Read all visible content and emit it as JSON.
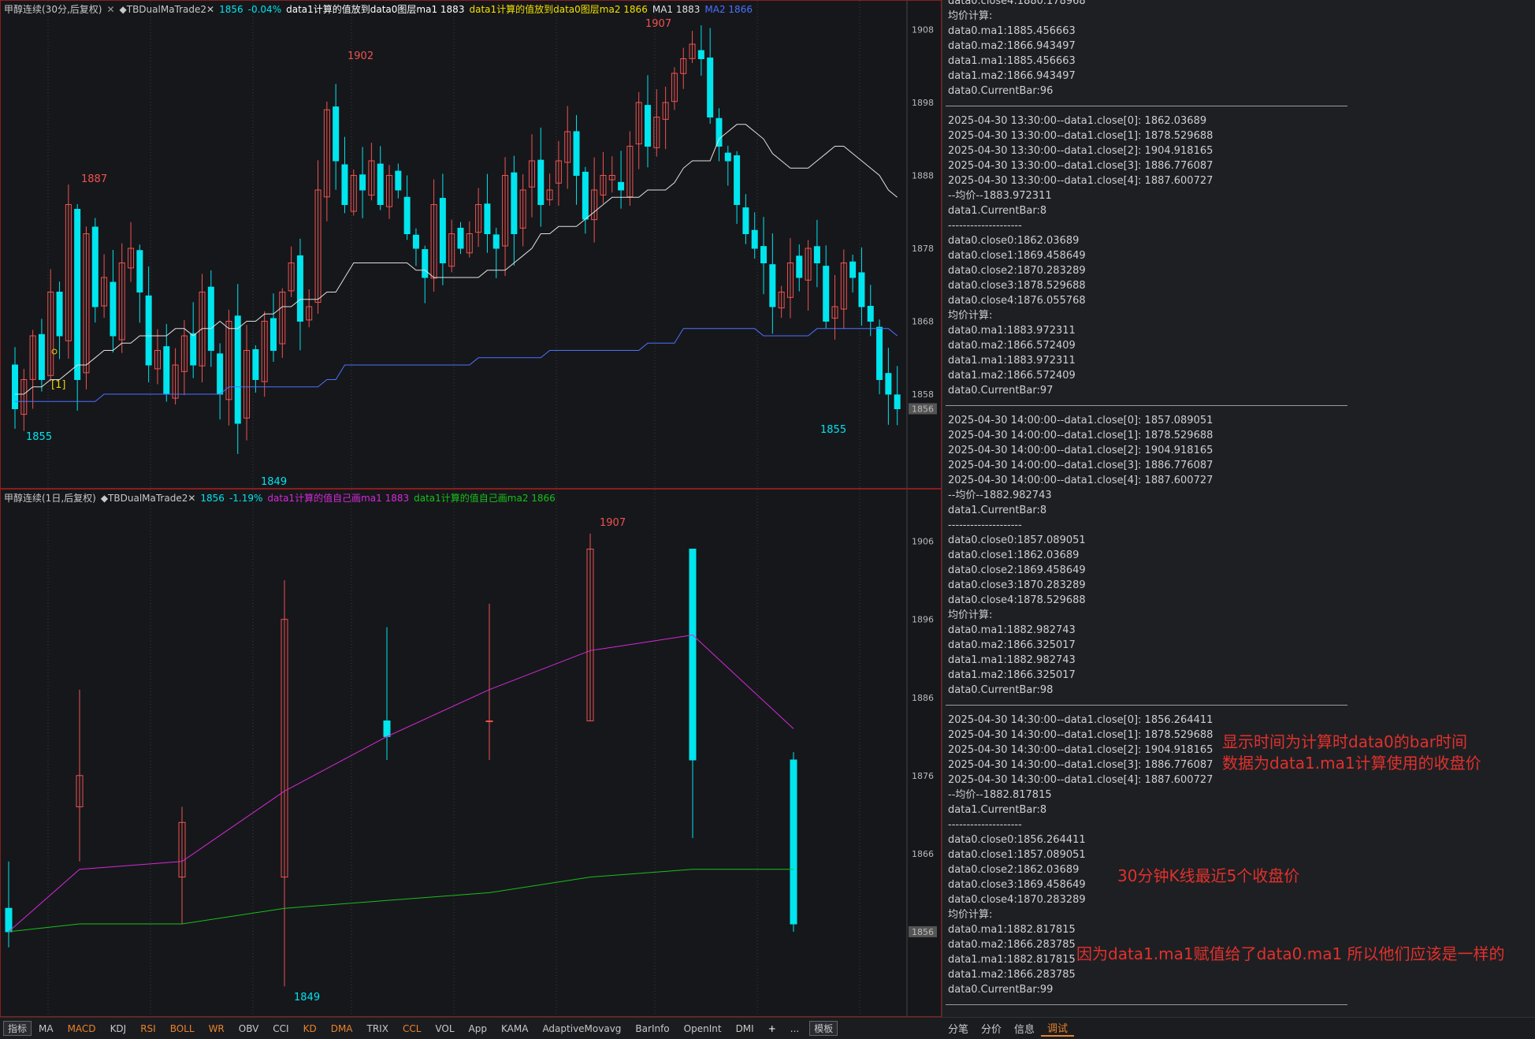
{
  "colors": {
    "up": "#ef5350",
    "down": "#00e5ee",
    "ma1": "#e0e0e0",
    "ma2": "#4a72ff",
    "ma1_daily": "#d62ad6",
    "ma2_daily": "#18c018",
    "label_cyan": "#00e5ee",
    "label_red": "#ef5350",
    "note": "#e2312b",
    "tab_orange": "#e8832a"
  },
  "pane1": {
    "header": [
      {
        "text": "甲醇连续(30分,后复权)",
        "color": "#c8c8c8"
      },
      {
        "text": "✕",
        "color": "#9a9a9a"
      },
      {
        "text": "◆TBDualMaTrade2✕",
        "color": "#c8c8c8"
      },
      {
        "text": "1856",
        "color": "#00e5ee"
      },
      {
        "text": "-0.04%",
        "color": "#00e5ee"
      },
      {
        "text": "data1计算的值放到data0图层ma1 1883",
        "color": "#ffffff"
      },
      {
        "text": "data1计算的值放到data0图层ma2 1866",
        "color": "#f2e000"
      },
      {
        "text": "MA1 1883",
        "color": "#e0e0e0"
      },
      {
        "text": "MA2 1866",
        "color": "#4a72ff"
      }
    ],
    "y_ticks": [
      "1908",
      "1898",
      "1888",
      "1878",
      "1868",
      "1858"
    ],
    "last_price": "1856",
    "annotations": {
      "high_left": "1887",
      "high_mid": "1902",
      "high_right": "1907",
      "low_left": "1855",
      "low_mid": "1849",
      "low_right": "1855",
      "signal": "[1]"
    }
  },
  "pane2": {
    "header": [
      {
        "text": "甲醇连续(1日,后复权)",
        "color": "#c8c8c8"
      },
      {
        "text": "◆TBDualMaTrade2✕",
        "color": "#c8c8c8"
      },
      {
        "text": "1856",
        "color": "#00e5ee"
      },
      {
        "text": "-1.19%",
        "color": "#00e5ee"
      },
      {
        "text": "data1计算的值自己画ma1 1883",
        "color": "#d62ad6"
      },
      {
        "text": "data1计算的值自己画ma2 1866",
        "color": "#18c018"
      }
    ],
    "y_ticks": [
      "1906",
      "1896",
      "1886",
      "1876",
      "1866"
    ],
    "last_price": "1856",
    "annotations": {
      "high": "1907",
      "low": "1849"
    }
  },
  "chart_data": [
    {
      "type": "candlestick",
      "title": "甲醇连续(30分,后复权)",
      "ylim": [
        1846,
        1910
      ],
      "y_ticks": [
        1908,
        1898,
        1888,
        1878,
        1868,
        1858
      ],
      "ma1": [
        1858,
        1858,
        1859,
        1859,
        1860,
        1860,
        1861,
        1862,
        1862,
        1863,
        1864,
        1864,
        1865,
        1865,
        1866,
        1866,
        1866,
        1866,
        1867,
        1867,
        1866,
        1867,
        1867,
        1868,
        1867,
        1867,
        1868,
        1868,
        1869,
        1869,
        1870,
        1870,
        1871,
        1871,
        1871,
        1872,
        1872,
        1874,
        1876,
        1876,
        1876,
        1876,
        1876,
        1876,
        1876,
        1875,
        1875,
        1874,
        1874,
        1874,
        1874,
        1874,
        1874,
        1875,
        1875,
        1875,
        1876,
        1877,
        1878,
        1880,
        1880,
        1881,
        1881,
        1881,
        1882,
        1883,
        1884,
        1885,
        1885,
        1885,
        1885,
        1886,
        1886,
        1886,
        1887,
        1889,
        1890,
        1890,
        1890,
        1893,
        1894,
        1895,
        1895,
        1894,
        1893,
        1891,
        1890,
        1889,
        1889,
        1889,
        1890,
        1891,
        1892,
        1892,
        1891,
        1890,
        1889,
        1888,
        1886,
        1885
      ],
      "ma2": [
        1857,
        1857,
        1857,
        1857,
        1857,
        1857,
        1857,
        1857,
        1857,
        1857,
        1858,
        1858,
        1858,
        1858,
        1858,
        1858,
        1858,
        1858,
        1858,
        1858,
        1858,
        1858,
        1858,
        1858,
        1859,
        1859,
        1859,
        1859,
        1859,
        1859,
        1859,
        1859,
        1859,
        1859,
        1859,
        1860,
        1860,
        1862,
        1862,
        1862,
        1862,
        1862,
        1862,
        1862,
        1862,
        1862,
        1862,
        1862,
        1862,
        1862,
        1862,
        1862,
        1863,
        1863,
        1863,
        1863,
        1863,
        1863,
        1863,
        1863,
        1864,
        1864,
        1864,
        1864,
        1864,
        1864,
        1864,
        1864,
        1864,
        1864,
        1864,
        1865,
        1865,
        1865,
        1865,
        1867,
        1867,
        1867,
        1867,
        1867,
        1867,
        1867,
        1867,
        1867,
        1866,
        1866,
        1866,
        1866,
        1866,
        1866,
        1867,
        1867,
        1867,
        1867,
        1867,
        1867,
        1867,
        1867,
        1867,
        1866
      ]
    },
    {
      "type": "candlestick",
      "title": "甲醇连续(1日,后复权)",
      "ylim": [
        1846,
        1910
      ],
      "y_ticks": [
        1906,
        1896,
        1886,
        1876,
        1866
      ],
      "candles": [
        {
          "o": 1859,
          "h": 1865,
          "l": 1854,
          "c": 1856
        },
        {
          "o": 1872,
          "h": 1887,
          "l": 1865,
          "c": 1876
        },
        {
          "o": 1863,
          "h": 1872,
          "l": 1857,
          "c": 1870
        },
        {
          "o": 1863,
          "h": 1901,
          "l": 1849,
          "c": 1896
        },
        {
          "o": 1883,
          "h": 1895,
          "l": 1878,
          "c": 1881
        },
        {
          "o": 1883,
          "h": 1898,
          "l": 1878,
          "c": 1883
        },
        {
          "o": 1883,
          "h": 1907,
          "l": 1883,
          "c": 1905
        },
        {
          "o": 1905,
          "h": 1905,
          "l": 1868,
          "c": 1878
        },
        {
          "o": 1878,
          "h": 1879,
          "l": 1856,
          "c": 1857
        }
      ],
      "ma1": [
        1856,
        1864,
        1865,
        1874,
        1881,
        1887,
        1892,
        1894,
        1882
      ],
      "ma2": [
        1856,
        1857,
        1857,
        1859,
        1860,
        1861,
        1863,
        1864,
        1864
      ]
    }
  ],
  "bottom_tabs": [
    {
      "label": "指标",
      "color": "#c8c8c8",
      "boxed": true
    },
    {
      "label": "MA",
      "color": "#c8c8c8"
    },
    {
      "label": "MACD",
      "color": "#e8832a"
    },
    {
      "label": "KDJ",
      "color": "#c8c8c8"
    },
    {
      "label": "RSI",
      "color": "#e8832a"
    },
    {
      "label": "BOLL",
      "color": "#e8832a"
    },
    {
      "label": "WR",
      "color": "#e8832a"
    },
    {
      "label": "OBV",
      "color": "#c8c8c8"
    },
    {
      "label": "CCI",
      "color": "#c8c8c8"
    },
    {
      "label": "KD",
      "color": "#e8832a"
    },
    {
      "label": "DMA",
      "color": "#e8832a"
    },
    {
      "label": "TRIX",
      "color": "#c8c8c8"
    },
    {
      "label": "CCL",
      "color": "#e8832a"
    },
    {
      "label": "VOL",
      "color": "#c8c8c8"
    },
    {
      "label": "App",
      "color": "#c8c8c8"
    },
    {
      "label": "KAMA",
      "color": "#c8c8c8"
    },
    {
      "label": "AdaptiveMovavg",
      "color": "#c8c8c8"
    },
    {
      "label": "BarInfo",
      "color": "#c8c8c8"
    },
    {
      "label": "OpenInt",
      "color": "#c8c8c8"
    },
    {
      "label": "DMI",
      "color": "#c8c8c8"
    },
    {
      "label": "+",
      "color": "#ffffff"
    },
    {
      "label": "...",
      "color": "#c8c8c8"
    },
    {
      "label": "模板",
      "color": "#c8c8c8",
      "boxed": true
    }
  ],
  "right_tabs": [
    {
      "label": "分笔",
      "active": false
    },
    {
      "label": "分价",
      "active": false
    },
    {
      "label": "信息",
      "active": false
    },
    {
      "label": "调试",
      "active": true
    }
  ],
  "log": [
    "data0.close4:1880.178968",
    "均价计算:",
    "data0.ma1:1885.456663",
    "data0.ma2:1866.943497",
    "data1.ma1:1885.456663",
    "data1.ma2:1866.943497",
    "data0.CurrentBar:96",
    "---",
    "2025-04-30 13:30:00--data1.close[0]:  1862.03689",
    "2025-04-30 13:30:00--data1.close[1]:  1878.529688",
    "2025-04-30 13:30:00--data1.close[2]:  1904.918165",
    "2025-04-30 13:30:00--data1.close[3]:  1886.776087",
    "2025-04-30 13:30:00--data1.close[4]:  1887.600727",
    "--均价--1883.972311",
    "data1.CurrentBar:8",
    "--------------------",
    "data0.close0:1862.03689",
    "data0.close1:1869.458649",
    "data0.close2:1870.283289",
    "data0.close3:1878.529688",
    "data0.close4:1876.055768",
    "均价计算:",
    "data0.ma1:1883.972311",
    "data0.ma2:1866.572409",
    "data1.ma1:1883.972311",
    "data1.ma2:1866.572409",
    "data0.CurrentBar:97",
    "---",
    "2025-04-30 14:00:00--data1.close[0]:  1857.089051",
    "2025-04-30 14:00:00--data1.close[1]:  1878.529688",
    "2025-04-30 14:00:00--data1.close[2]:  1904.918165",
    "2025-04-30 14:00:00--data1.close[3]:  1886.776087",
    "2025-04-30 14:00:00--data1.close[4]:  1887.600727",
    "--均价--1882.982743",
    "data1.CurrentBar:8",
    "--------------------",
    "data0.close0:1857.089051",
    "data0.close1:1862.03689",
    "data0.close2:1869.458649",
    "data0.close3:1870.283289",
    "data0.close4:1878.529688",
    "均价计算:",
    "data0.ma1:1882.982743",
    "data0.ma2:1866.325017",
    "data1.ma1:1882.982743",
    "data1.ma2:1866.325017",
    "data0.CurrentBar:98",
    "---",
    "2025-04-30 14:30:00--data1.close[0]:  1856.264411",
    "2025-04-30 14:30:00--data1.close[1]:  1878.529688",
    "2025-04-30 14:30:00--data1.close[2]:  1904.918165",
    "2025-04-30 14:30:00--data1.close[3]:  1886.776087",
    "2025-04-30 14:30:00--data1.close[4]:  1887.600727",
    "--均价--1882.817815",
    "data1.CurrentBar:8",
    "--------------------",
    "data0.close0:1856.264411",
    "data0.close1:1857.089051",
    "data0.close2:1862.03689",
    "data0.close3:1869.458649",
    "data0.close4:1870.283289",
    "均价计算:",
    "data0.ma1:1882.817815",
    "data0.ma2:1866.283785",
    "data1.ma1:1882.817815",
    "data1.ma2:1866.283785",
    "data0.CurrentBar:99",
    "---"
  ],
  "notes": {
    "note1_line1": "显示时间为计算时data0的bar时间",
    "note1_line2": "数据为data1.ma1计算使用的收盘价",
    "note2": "30分钟K线最近5个收盘价",
    "note3": "因为data1.ma1赋值给了data0.ma1 所以他们应该是一样的"
  }
}
